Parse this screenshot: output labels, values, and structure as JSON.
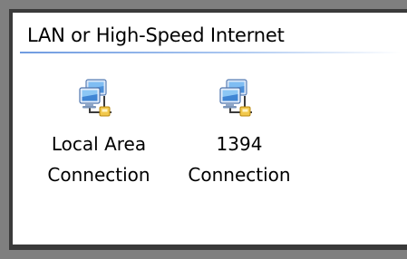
{
  "group": {
    "header": "LAN or High-Speed Internet"
  },
  "items": [
    {
      "line1": "Local Area",
      "line2": "Connection",
      "icon": "network-connection-icon"
    },
    {
      "line1": "1394",
      "line2": "Connection",
      "icon": "network-connection-icon"
    }
  ],
  "colors": {
    "rule_start": "#6f9be0",
    "frame": "#7f7f7f",
    "window_border": "#3a3a3a"
  }
}
